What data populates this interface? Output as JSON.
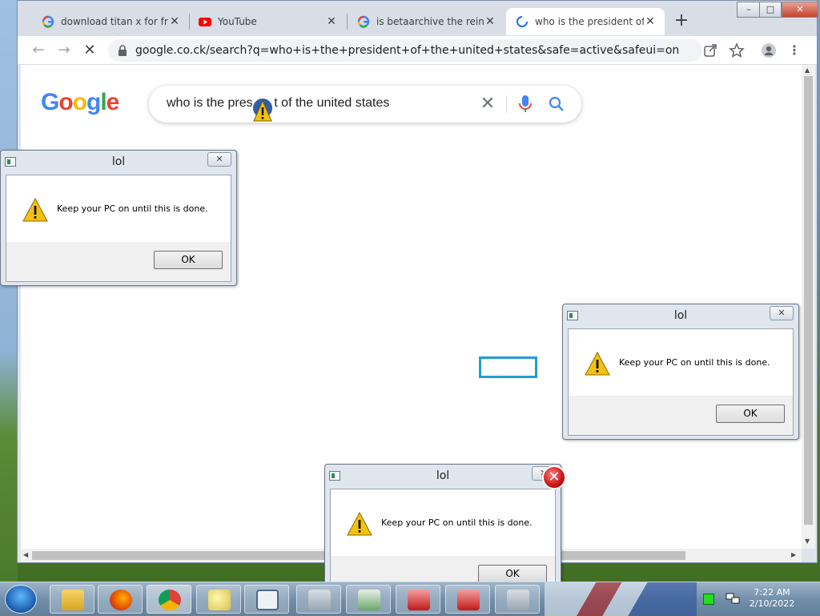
{
  "browser": {
    "tabs": [
      {
        "title": "download titan x for free",
        "favicon": "google-icon",
        "active": false
      },
      {
        "title": "YouTube",
        "favicon": "youtube-icon",
        "active": false
      },
      {
        "title": "is betaarchive the reincar",
        "favicon": "google-icon",
        "active": false
      },
      {
        "title": "who is the president of th",
        "favicon": "loading-spinner-icon",
        "active": true
      }
    ],
    "new_tab_label": "+",
    "window_controls": {
      "minimize": "–",
      "maximize": "□",
      "close": "✕"
    },
    "url": "google.co.ck/search?q=who+is+the+president+of+the+united+states&safe=active&safeui=on",
    "nav": {
      "back": "←",
      "forward": "→",
      "stop": "✕"
    }
  },
  "google": {
    "logo_letters": [
      {
        "ch": "G",
        "color": "#4285F4"
      },
      {
        "ch": "o",
        "color": "#EA4335"
      },
      {
        "ch": "o",
        "color": "#FBBC05"
      },
      {
        "ch": "g",
        "color": "#4285F4"
      },
      {
        "ch": "l",
        "color": "#34A853"
      },
      {
        "ch": "e",
        "color": "#EA4335"
      }
    ],
    "query": "who is the pres      t of the united states",
    "clear_label": "✕"
  },
  "dialogs": [
    {
      "title": "lol",
      "message": "Keep your PC on until this is done.",
      "ok": "OK",
      "close": "✕"
    },
    {
      "title": "lol",
      "message": "Keep your PC on until this is done.",
      "ok": "OK",
      "close": "✕"
    },
    {
      "title": "lol",
      "message": "Keep your PC on until this is done.",
      "ok": "OK",
      "close": "✕"
    }
  ],
  "taskbar": {
    "time": "7:22 AM",
    "date": "2/10/2022"
  },
  "colors": {
    "focus_rect": "#1e9ed8",
    "error_red": "#c81414",
    "warning_yellow": "#f4c20d"
  }
}
